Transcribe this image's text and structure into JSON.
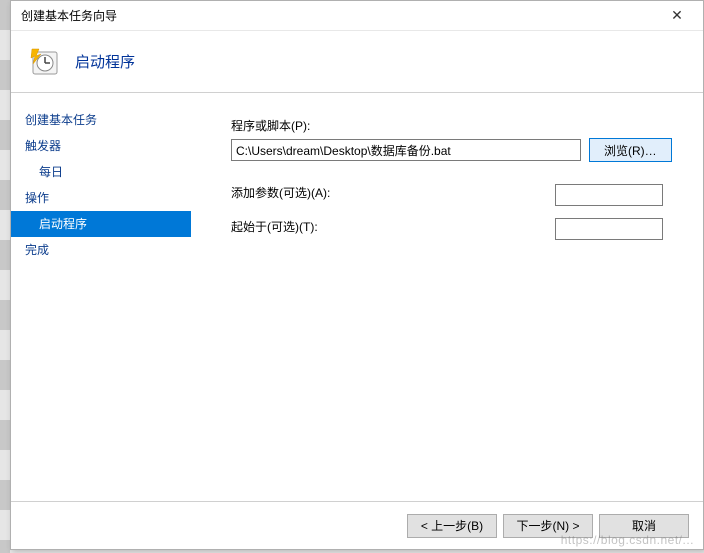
{
  "titlebar": {
    "title": "创建基本任务向导"
  },
  "header": {
    "title": "启动程序"
  },
  "sidebar": {
    "items": [
      {
        "label": "创建基本任务",
        "child": false
      },
      {
        "label": "触发器",
        "child": false
      },
      {
        "label": "每日",
        "child": true
      },
      {
        "label": "操作",
        "child": false
      },
      {
        "label": "启动程序",
        "child": true,
        "active": true
      },
      {
        "label": "完成",
        "child": false
      }
    ]
  },
  "main": {
    "script_label": "程序或脚本(P):",
    "script_value": "C:\\Users\\dream\\Desktop\\数据库备份.bat",
    "browse_label": "浏览(R)…",
    "args_label": "添加参数(可选)(A):",
    "args_value": "",
    "startin_label": "起始于(可选)(T):",
    "startin_value": ""
  },
  "footer": {
    "back": "< 上一步(B)",
    "next": "下一步(N) >",
    "cancel": "取消"
  },
  "icons": {
    "close": "✕"
  }
}
